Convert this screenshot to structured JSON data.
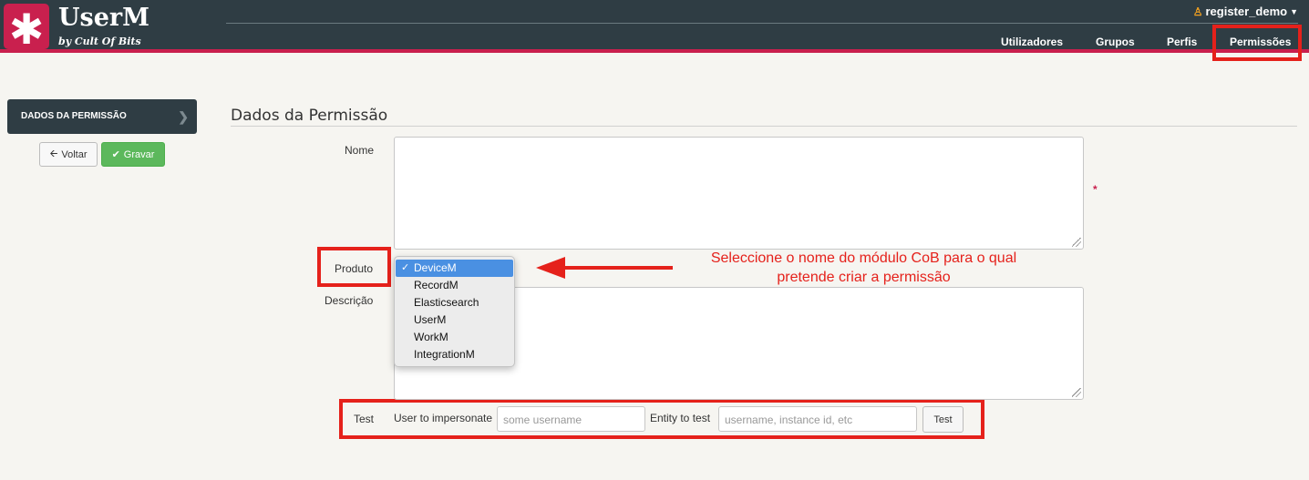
{
  "brand": {
    "logo_glyph": "✱",
    "name": "UserM",
    "tagline": "by Cult Of Bits",
    "accent": "#c9204e",
    "header_bg": "#2f3d44"
  },
  "user_menu": {
    "username": "register_demo",
    "icon": "user-icon"
  },
  "nav": {
    "users": "Utilizadores",
    "groups": "Grupos",
    "profiles": "Perfis",
    "permissions": "Permissões"
  },
  "sidebar": {
    "section": "DADOS DA PERMISSÃO",
    "back_label": "Voltar",
    "save_label": "Gravar"
  },
  "form": {
    "title": "Dados da Permissão",
    "name_label": "Nome",
    "required_mark": "*",
    "product_label": "Produto",
    "product_options": [
      "DeviceM",
      "RecordM",
      "Elasticsearch",
      "UserM",
      "WorkM",
      "IntegrationM"
    ],
    "product_selected": "DeviceM",
    "description_label": "Descrição"
  },
  "test": {
    "label": "Test",
    "user_label": "User to impersonate",
    "user_placeholder": "some username",
    "entity_label": "Entity to test",
    "entity_placeholder": "username, instance id, etc",
    "button_label": "Test"
  },
  "annotation": {
    "line1": "Seleccione o nome do módulo CoB para o qual",
    "line2": "pretende criar a permissão",
    "color": "#e5211b"
  }
}
